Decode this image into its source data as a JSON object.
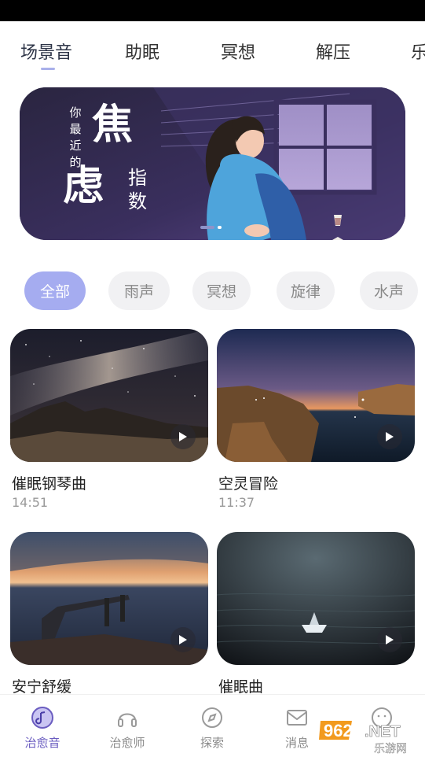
{
  "top_tabs": [
    {
      "label": "场景音",
      "active": true
    },
    {
      "label": "助眠",
      "active": false
    },
    {
      "label": "冥想",
      "active": false
    },
    {
      "label": "解压",
      "active": false
    },
    {
      "label": "乐",
      "active": false
    }
  ],
  "banner": {
    "small_text": "你最近的",
    "big_char_1": "焦",
    "big_char_2": "虑",
    "side_text": "指数",
    "page_count": 2,
    "current_page": 1
  },
  "chips": [
    {
      "label": "全部",
      "active": true
    },
    {
      "label": "雨声",
      "active": false
    },
    {
      "label": "冥想",
      "active": false
    },
    {
      "label": "旋律",
      "active": false
    },
    {
      "label": "水声",
      "active": false
    }
  ],
  "cards": [
    {
      "title": "催眠钢琴曲",
      "duration": "14:51",
      "scene": "night-sky-icon"
    },
    {
      "title": "空灵冒险",
      "duration": "11:37",
      "scene": "coast-icon"
    },
    {
      "title": "安宁舒缓",
      "duration": "",
      "scene": "sunset-pier-icon"
    },
    {
      "title": "催眠曲",
      "duration": "",
      "scene": "water-boat-icon"
    }
  ],
  "bottom_nav": [
    {
      "label": "治愈音",
      "icon": "music-disc-icon",
      "active": true
    },
    {
      "label": "治愈师",
      "icon": "headphone-icon",
      "active": false
    },
    {
      "label": "探索",
      "icon": "compass-icon",
      "active": false
    },
    {
      "label": "消息",
      "icon": "mail-icon",
      "active": false
    },
    {
      "label": "",
      "icon": "profile-icon",
      "active": false
    }
  ],
  "watermark": {
    "text1": "962",
    "text2": ".NET",
    "text3": "乐游网"
  },
  "colors": {
    "accent": "#a5acf0",
    "active_nav": "#6a5cc0",
    "banner_bg": "#2d2744"
  }
}
